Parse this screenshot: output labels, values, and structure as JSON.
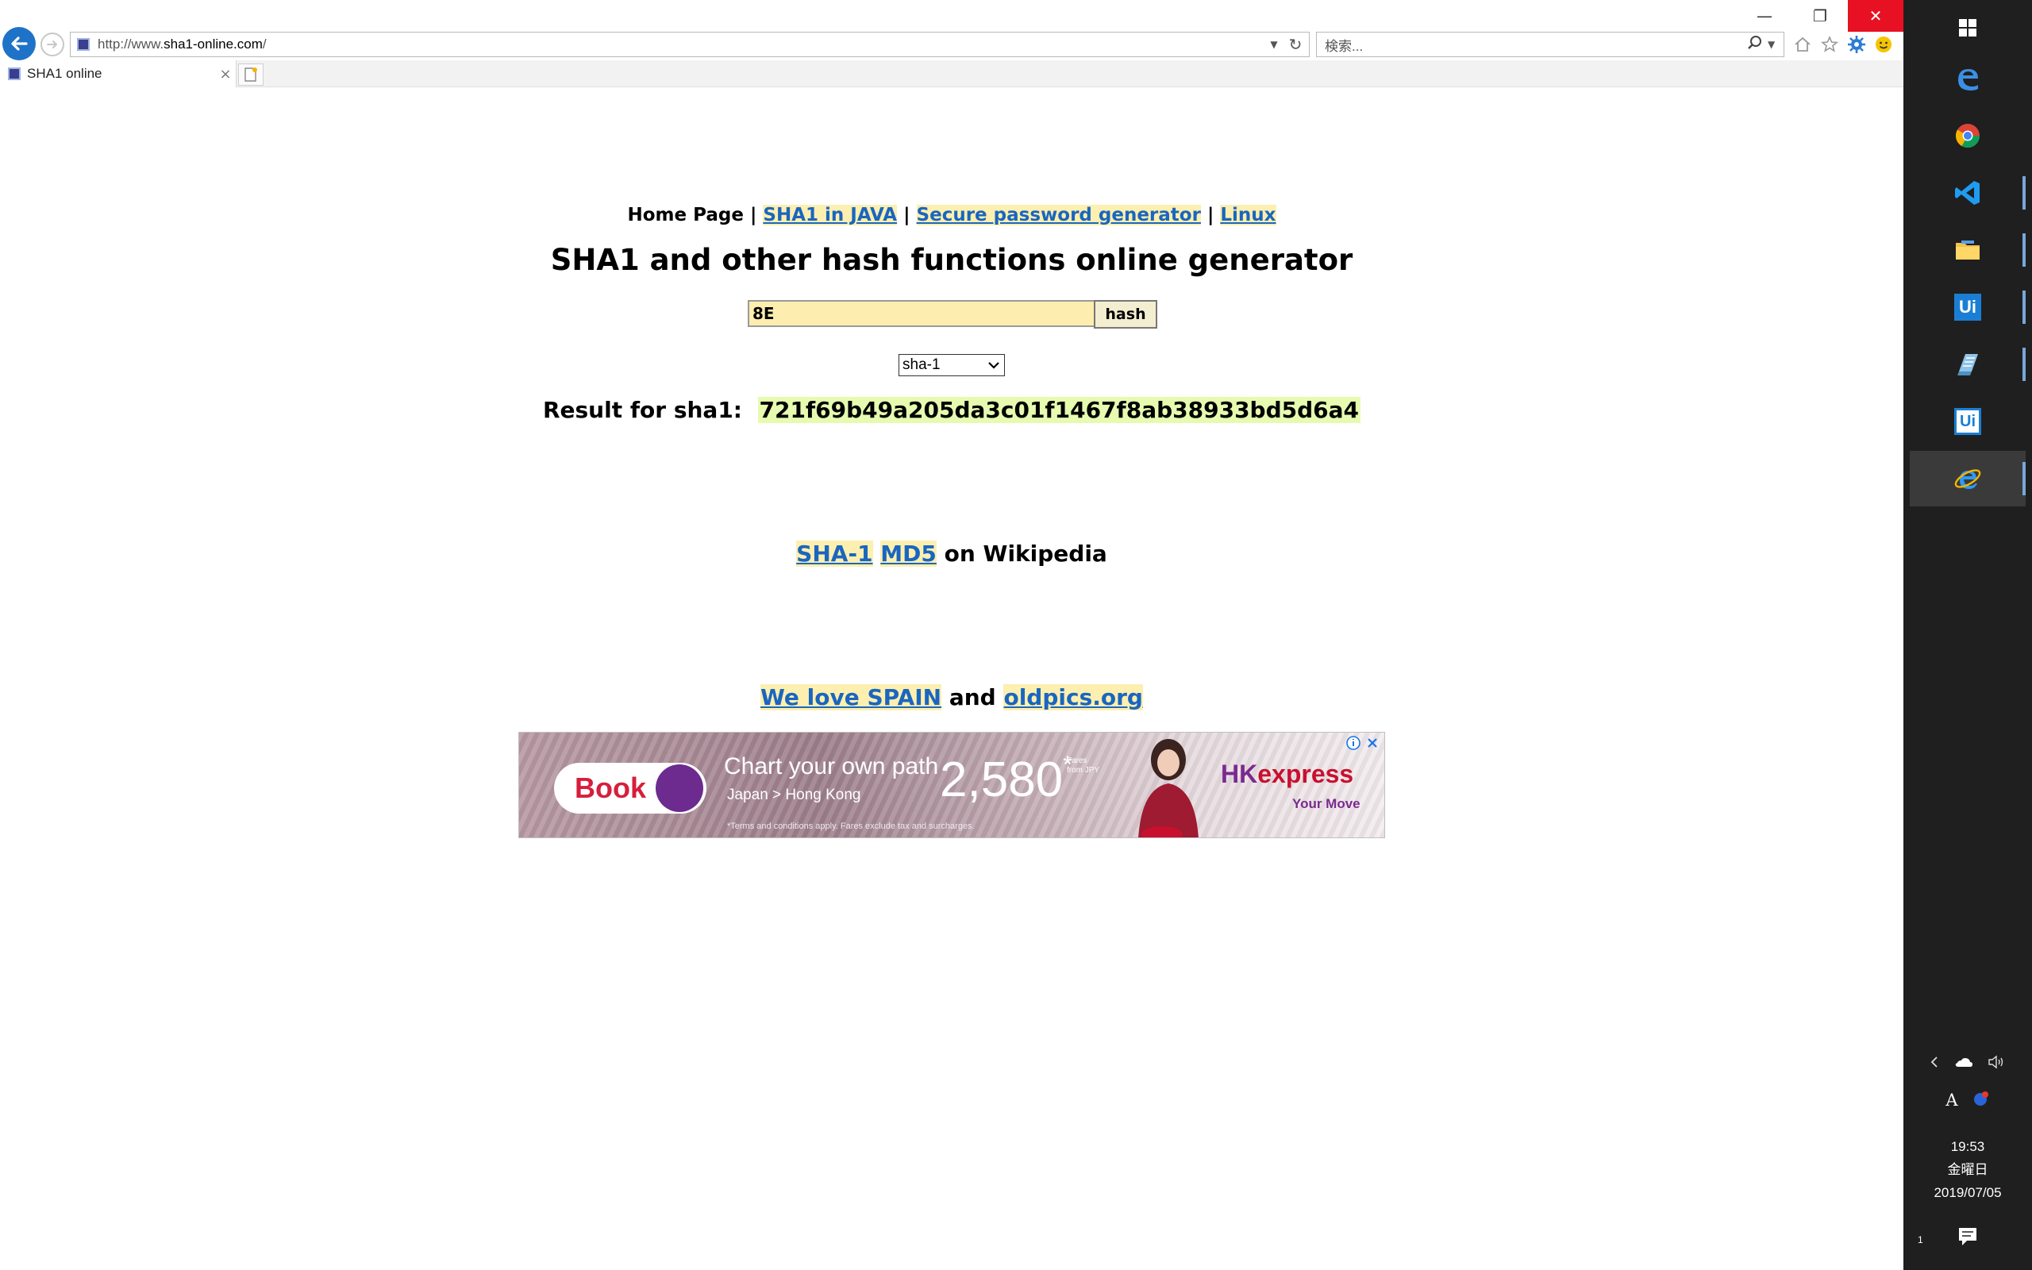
{
  "browser": {
    "address": {
      "url_prefix": "http://www.",
      "url_domain": "sha1-online.com",
      "url_suffix": "/"
    },
    "search": {
      "placeholder": "検索..."
    },
    "tab": {
      "title": "SHA1 online",
      "close": "×"
    },
    "window_controls": {
      "minimize": "—",
      "restore": "❐",
      "close": "✕"
    }
  },
  "page": {
    "nav": {
      "home": "Home Page",
      "separator": "|",
      "java": "SHA1 in JAVA",
      "password": "Secure password generator",
      "linux": "Linux"
    },
    "title": "SHA1 and other hash functions online generator",
    "form": {
      "input_value": "8E",
      "button_label": "hash",
      "algorithm": "sha-1"
    },
    "result": {
      "label": "Result for sha1:",
      "hash": "721f69b49a205da3c01f1467f8ab38933bd5d6a4"
    },
    "wiki": {
      "sha1": "SHA-1",
      "md5": "MD5",
      "suffix": "on Wikipedia"
    },
    "promo": {
      "spain": "We love SPAIN",
      "and": "and",
      "oldpics": "oldpics.org"
    }
  },
  "ad": {
    "book": "Book",
    "headline": "Chart your own path",
    "route": "Japan > Hong Kong",
    "price": "2,580",
    "price_mark": "*",
    "fares_line1": "Fares",
    "fares_line2": "from JPY",
    "terms": "*Terms and conditions apply. Fares exclude tax and surcharges.",
    "brand_hk": "HK",
    "brand_express": "express",
    "tagline": "Your Move",
    "colors": {
      "book": "#d61f3c",
      "brand": "#7a2a8f",
      "circle": "#6d2a8f"
    }
  },
  "taskbar": {
    "apps": [
      "windows-start",
      "edge",
      "chrome",
      "vscode",
      "file-explorer",
      "uipath-studio",
      "notepad",
      "uipath-robot",
      "internet-explorer"
    ],
    "ui_label_1": "Ui",
    "ui_label_2": "Ui",
    "tray": {
      "ime": "A"
    },
    "clock": {
      "time": "19:53",
      "day": "金曜日",
      "date": "2019/07/05"
    },
    "notification_count": "1"
  }
}
